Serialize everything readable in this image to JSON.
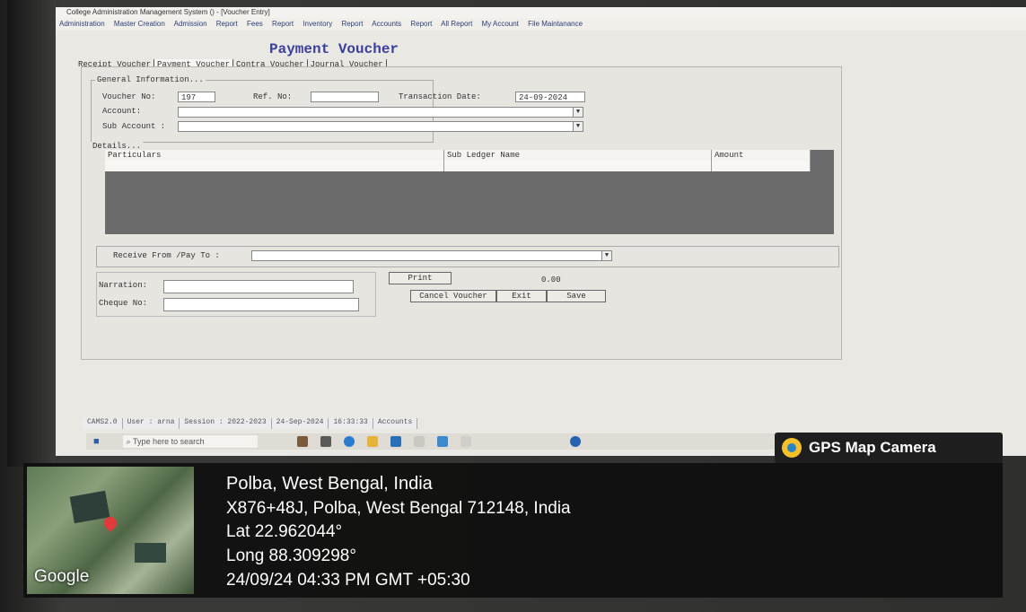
{
  "window": {
    "title": "College Administration Management System () - [Voucher Entry]",
    "menu": [
      "Administration",
      "Master Creation",
      "Admission",
      "Report",
      "Fees",
      "Report",
      "Inventory",
      "Report",
      "Accounts",
      "Report",
      "All Report",
      "My Account",
      "File Maintanance"
    ]
  },
  "form": {
    "heading": "Payment Voucher",
    "tabs": [
      "Receipt Voucher",
      "Payment Voucher",
      "Contra Voucher",
      "Journal Voucher"
    ],
    "general": {
      "label": "General Information...",
      "voucher_no_label": "Voucher No:",
      "voucher_no": "197",
      "ref_no_label": "Ref. No:",
      "ref_no": "",
      "transaction_date_label": "Transaction Date:",
      "transaction_date": "24-09-2024",
      "account_label": "Account:",
      "sub_account_label": "Sub Account :"
    },
    "details": {
      "label": "Details...",
      "columns": [
        "Particulars",
        "Sub Ledger Name",
        "Amount"
      ]
    },
    "receive_from_label": "Receive From /Pay To :",
    "narration_label": "Narration:",
    "cheque_no_label": "Cheque No:",
    "total": "0.00",
    "buttons": {
      "print": "Print",
      "cancel_voucher": "Cancel Voucher",
      "exit": "Exit",
      "save": "Save"
    }
  },
  "statusbar": [
    "CAMS2.0",
    "User : arna",
    "Session : 2022-2023",
    "24-Sep-2024",
    "16:33:33",
    "Accounts"
  ],
  "taskbar": {
    "search_placeholder": "Type here to search"
  },
  "gps": {
    "badge": "GPS Map Camera",
    "place": "Polba, West Bengal, India",
    "address": "X876+48J, Polba, West Bengal 712148, India",
    "lat": "Lat 22.962044°",
    "long": "Long 88.309298°",
    "datetime": "24/09/24 04:33 PM GMT +05:30",
    "map_brand": "Google"
  },
  "colors": {
    "heading": "#3b3f9e",
    "menu_text": "#2b3d7a",
    "pin": "#e03a3a",
    "camera_icon": "#f4c12b"
  }
}
